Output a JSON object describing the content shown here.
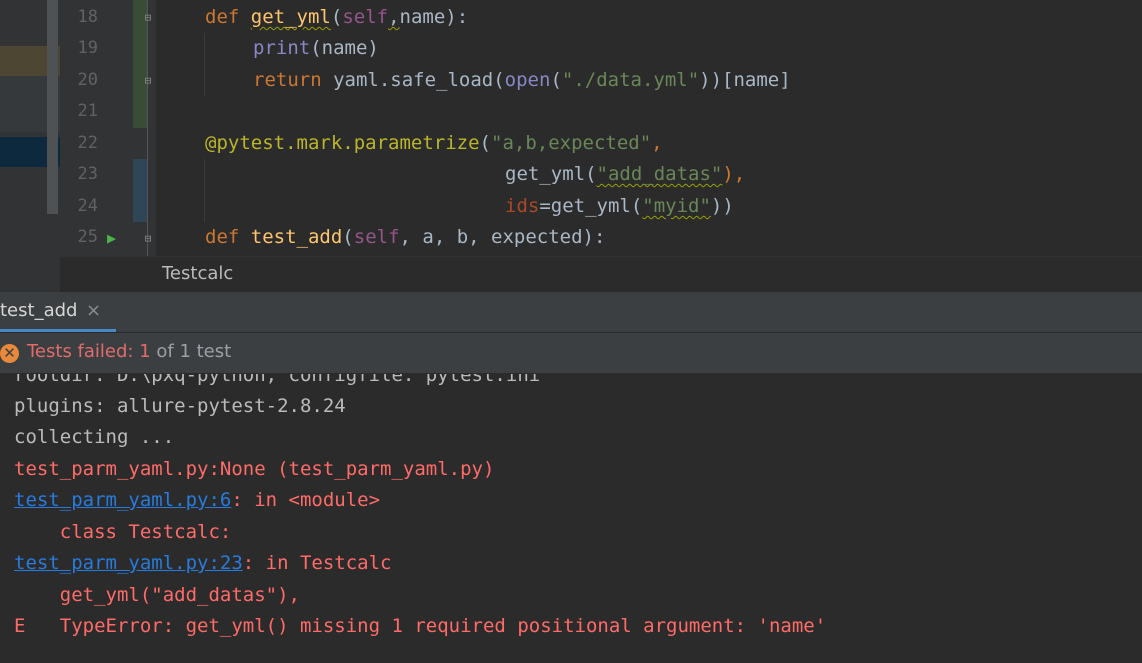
{
  "editor": {
    "line_numbers": [
      "18",
      "19",
      "20",
      "21",
      "22",
      "23",
      "24",
      "25"
    ],
    "line18": {
      "kw": "def",
      "fn": "get_yml",
      "p1": "(",
      "self": "self",
      "comma": ",",
      "param": "name",
      "p2": "):"
    },
    "line19": {
      "bi": "print",
      "rest": "(name)"
    },
    "line20": {
      "kw": "return",
      "a": " yaml.safe_load(",
      "bi": "open",
      "b": "(",
      "str": "\"./data.yml\"",
      "c": "))[name]"
    },
    "line22": {
      "dec": "@pytest.mark.parametrize",
      "a": "(",
      "str": "\"a,b,expected\"",
      "b": ","
    },
    "line23": {
      "a": "get_yml(",
      "str": "\"add_datas\"",
      "b": "),"
    },
    "line24": {
      "param": "ids",
      "a": "=get_yml(",
      "str": "\"myid\"",
      "b": "))"
    },
    "line25": {
      "kw": "def",
      "fn": "test_add",
      "p1": "(",
      "self": "self",
      "rest": ", a, b, expected):"
    },
    "breadcrumb": "Testcalc"
  },
  "run_panel": {
    "tab_label": "test_add",
    "close_glyph": "×",
    "status": {
      "prefix": "Tests failed: 1",
      "suffix": " of 1 test",
      "icon_glyph": "✕"
    }
  },
  "console": {
    "lines": [
      "rootdir: D:\\pxq-python, configfile: pytest.ini",
      "plugins: allure-pytest-2.8.24",
      "collecting ...",
      "test_parm_yaml.py:None (test_parm_yaml.py)",
      {
        "link": "test_parm_yaml.py:6",
        "rest": ": in <module>"
      },
      "    class Testcalc:",
      {
        "link": "test_parm_yaml.py:23",
        "rest": ": in Testcalc"
      },
      "    get_yml(\"add_datas\"),",
      "E   TypeError: get_yml() missing 1 required positional argument: 'name'"
    ]
  },
  "colors": {
    "editor_bg": "#2b2b2b",
    "gutter_bg": "#313335",
    "keyword": "#cc7832",
    "function": "#ffc66d",
    "string": "#6a8759",
    "error": "#ff6b68",
    "link": "#287bde",
    "accent": "#4a88c7"
  }
}
